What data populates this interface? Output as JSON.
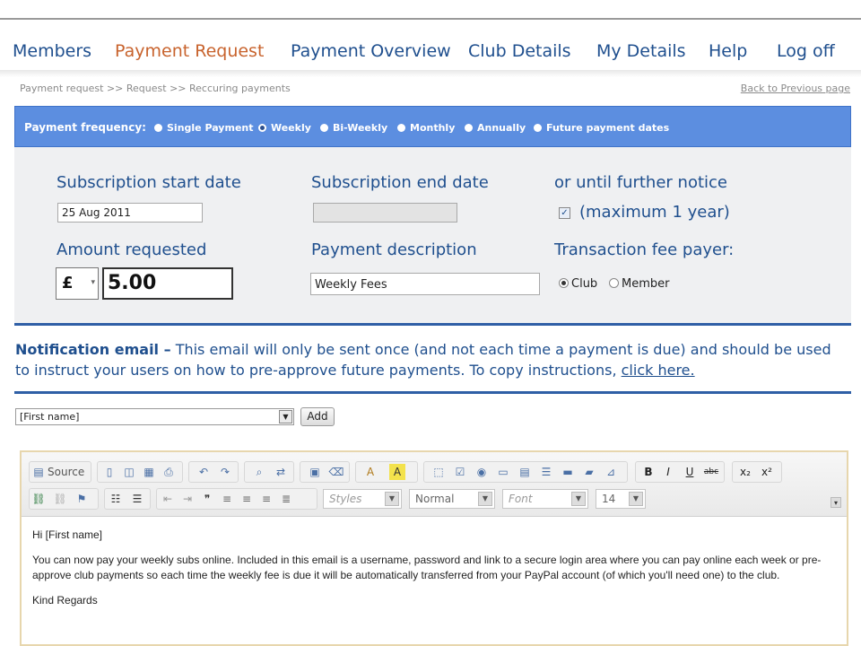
{
  "nav": {
    "items": [
      {
        "label": "Members",
        "active": false
      },
      {
        "label": "Payment Request",
        "active": true
      },
      {
        "label": "Payment Overview",
        "active": false
      },
      {
        "label": "Club Details",
        "active": false
      },
      {
        "label": "My Details",
        "active": false
      },
      {
        "label": "Help",
        "active": false
      },
      {
        "label": "Log off",
        "active": false
      }
    ]
  },
  "breadcrumb": "Payment request >> Request >> Reccuring payments",
  "back_link": "Back to Previous page",
  "frequency": {
    "label": "Payment frequency:",
    "options": [
      "Single Payment",
      "Weekly",
      "Bi-Weekly",
      "Monthly",
      "Annually",
      "Future payment dates"
    ],
    "selected": "Weekly"
  },
  "form": {
    "start_label": "Subscription start date",
    "start_value": "25 Aug 2011",
    "end_label": "Subscription end date",
    "end_value": "",
    "until_label": "or until further notice",
    "until_checked": true,
    "until_checkbox_label": "(maximum 1 year)",
    "amount_label": "Amount requested",
    "currency": "£",
    "amount": "5.00",
    "desc_label": "Payment description",
    "desc_value": "Weekly Fees",
    "fee_label": "Transaction fee payer:",
    "fee_options": [
      "Club",
      "Member"
    ],
    "fee_selected": "Club"
  },
  "notice": {
    "heading": "Notification email –",
    "text": " This email will only be sent once (and not each time a payment is due) and should be used to instruct your users on how to pre-approve future payments. To copy instructions, ",
    "link": "click here."
  },
  "field_select": {
    "value": "[First name]",
    "add_label": "Add"
  },
  "editor": {
    "source_label": "Source",
    "styles_placeholder": "Styles",
    "format_value": "Normal",
    "font_placeholder": "Font",
    "size_value": "14",
    "content": [
      "Hi [First name]",
      "You can now pay your weekly subs online.  Included in this email is a username, password and link to a secure login area where you can pay online each week or pre-approve club payments so each time the weekly fee is due it will be automatically transferred from your PayPal account (of which you'll need one) to the club.",
      "Kind Regards"
    ]
  },
  "colors": {
    "nav": "#1f4f8e",
    "nav_active": "#c8632d",
    "freq_bar": "#5c8ee0",
    "rule": "#2f5fa6"
  }
}
